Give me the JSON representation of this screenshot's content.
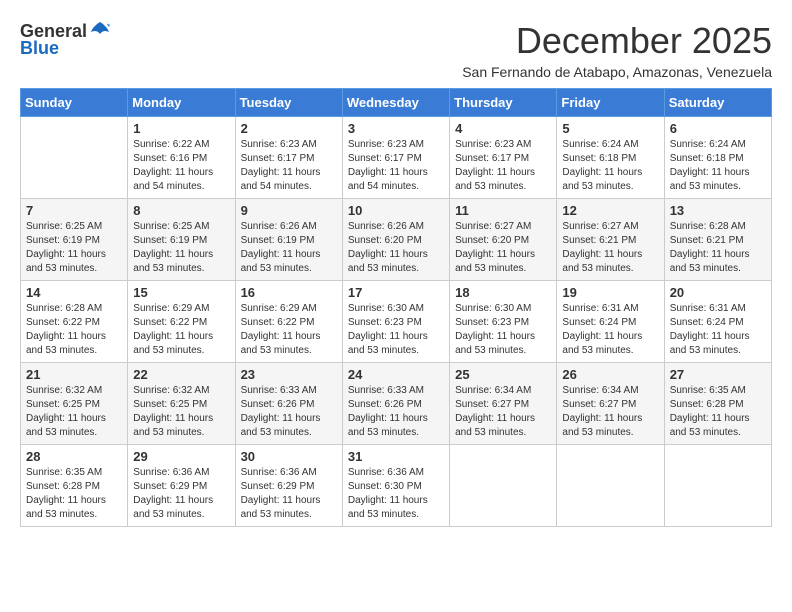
{
  "header": {
    "logo_line1": "General",
    "logo_line2": "Blue",
    "month": "December 2025",
    "location": "San Fernando de Atabapo, Amazonas, Venezuela"
  },
  "calendar": {
    "days_of_week": [
      "Sunday",
      "Monday",
      "Tuesday",
      "Wednesday",
      "Thursday",
      "Friday",
      "Saturday"
    ],
    "weeks": [
      [
        {
          "day": "",
          "info": ""
        },
        {
          "day": "1",
          "info": "Sunrise: 6:22 AM\nSunset: 6:16 PM\nDaylight: 11 hours\nand 54 minutes."
        },
        {
          "day": "2",
          "info": "Sunrise: 6:23 AM\nSunset: 6:17 PM\nDaylight: 11 hours\nand 54 minutes."
        },
        {
          "day": "3",
          "info": "Sunrise: 6:23 AM\nSunset: 6:17 PM\nDaylight: 11 hours\nand 54 minutes."
        },
        {
          "day": "4",
          "info": "Sunrise: 6:23 AM\nSunset: 6:17 PM\nDaylight: 11 hours\nand 53 minutes."
        },
        {
          "day": "5",
          "info": "Sunrise: 6:24 AM\nSunset: 6:18 PM\nDaylight: 11 hours\nand 53 minutes."
        },
        {
          "day": "6",
          "info": "Sunrise: 6:24 AM\nSunset: 6:18 PM\nDaylight: 11 hours\nand 53 minutes."
        }
      ],
      [
        {
          "day": "7",
          "info": "Sunrise: 6:25 AM\nSunset: 6:19 PM\nDaylight: 11 hours\nand 53 minutes."
        },
        {
          "day": "8",
          "info": "Sunrise: 6:25 AM\nSunset: 6:19 PM\nDaylight: 11 hours\nand 53 minutes."
        },
        {
          "day": "9",
          "info": "Sunrise: 6:26 AM\nSunset: 6:19 PM\nDaylight: 11 hours\nand 53 minutes."
        },
        {
          "day": "10",
          "info": "Sunrise: 6:26 AM\nSunset: 6:20 PM\nDaylight: 11 hours\nand 53 minutes."
        },
        {
          "day": "11",
          "info": "Sunrise: 6:27 AM\nSunset: 6:20 PM\nDaylight: 11 hours\nand 53 minutes."
        },
        {
          "day": "12",
          "info": "Sunrise: 6:27 AM\nSunset: 6:21 PM\nDaylight: 11 hours\nand 53 minutes."
        },
        {
          "day": "13",
          "info": "Sunrise: 6:28 AM\nSunset: 6:21 PM\nDaylight: 11 hours\nand 53 minutes."
        }
      ],
      [
        {
          "day": "14",
          "info": "Sunrise: 6:28 AM\nSunset: 6:22 PM\nDaylight: 11 hours\nand 53 minutes."
        },
        {
          "day": "15",
          "info": "Sunrise: 6:29 AM\nSunset: 6:22 PM\nDaylight: 11 hours\nand 53 minutes."
        },
        {
          "day": "16",
          "info": "Sunrise: 6:29 AM\nSunset: 6:22 PM\nDaylight: 11 hours\nand 53 minutes."
        },
        {
          "day": "17",
          "info": "Sunrise: 6:30 AM\nSunset: 6:23 PM\nDaylight: 11 hours\nand 53 minutes."
        },
        {
          "day": "18",
          "info": "Sunrise: 6:30 AM\nSunset: 6:23 PM\nDaylight: 11 hours\nand 53 minutes."
        },
        {
          "day": "19",
          "info": "Sunrise: 6:31 AM\nSunset: 6:24 PM\nDaylight: 11 hours\nand 53 minutes."
        },
        {
          "day": "20",
          "info": "Sunrise: 6:31 AM\nSunset: 6:24 PM\nDaylight: 11 hours\nand 53 minutes."
        }
      ],
      [
        {
          "day": "21",
          "info": "Sunrise: 6:32 AM\nSunset: 6:25 PM\nDaylight: 11 hours\nand 53 minutes."
        },
        {
          "day": "22",
          "info": "Sunrise: 6:32 AM\nSunset: 6:25 PM\nDaylight: 11 hours\nand 53 minutes."
        },
        {
          "day": "23",
          "info": "Sunrise: 6:33 AM\nSunset: 6:26 PM\nDaylight: 11 hours\nand 53 minutes."
        },
        {
          "day": "24",
          "info": "Sunrise: 6:33 AM\nSunset: 6:26 PM\nDaylight: 11 hours\nand 53 minutes."
        },
        {
          "day": "25",
          "info": "Sunrise: 6:34 AM\nSunset: 6:27 PM\nDaylight: 11 hours\nand 53 minutes."
        },
        {
          "day": "26",
          "info": "Sunrise: 6:34 AM\nSunset: 6:27 PM\nDaylight: 11 hours\nand 53 minutes."
        },
        {
          "day": "27",
          "info": "Sunrise: 6:35 AM\nSunset: 6:28 PM\nDaylight: 11 hours\nand 53 minutes."
        }
      ],
      [
        {
          "day": "28",
          "info": "Sunrise: 6:35 AM\nSunset: 6:28 PM\nDaylight: 11 hours\nand 53 minutes."
        },
        {
          "day": "29",
          "info": "Sunrise: 6:36 AM\nSunset: 6:29 PM\nDaylight: 11 hours\nand 53 minutes."
        },
        {
          "day": "30",
          "info": "Sunrise: 6:36 AM\nSunset: 6:29 PM\nDaylight: 11 hours\nand 53 minutes."
        },
        {
          "day": "31",
          "info": "Sunrise: 6:36 AM\nSunset: 6:30 PM\nDaylight: 11 hours\nand 53 minutes."
        },
        {
          "day": "",
          "info": ""
        },
        {
          "day": "",
          "info": ""
        },
        {
          "day": "",
          "info": ""
        }
      ]
    ]
  }
}
